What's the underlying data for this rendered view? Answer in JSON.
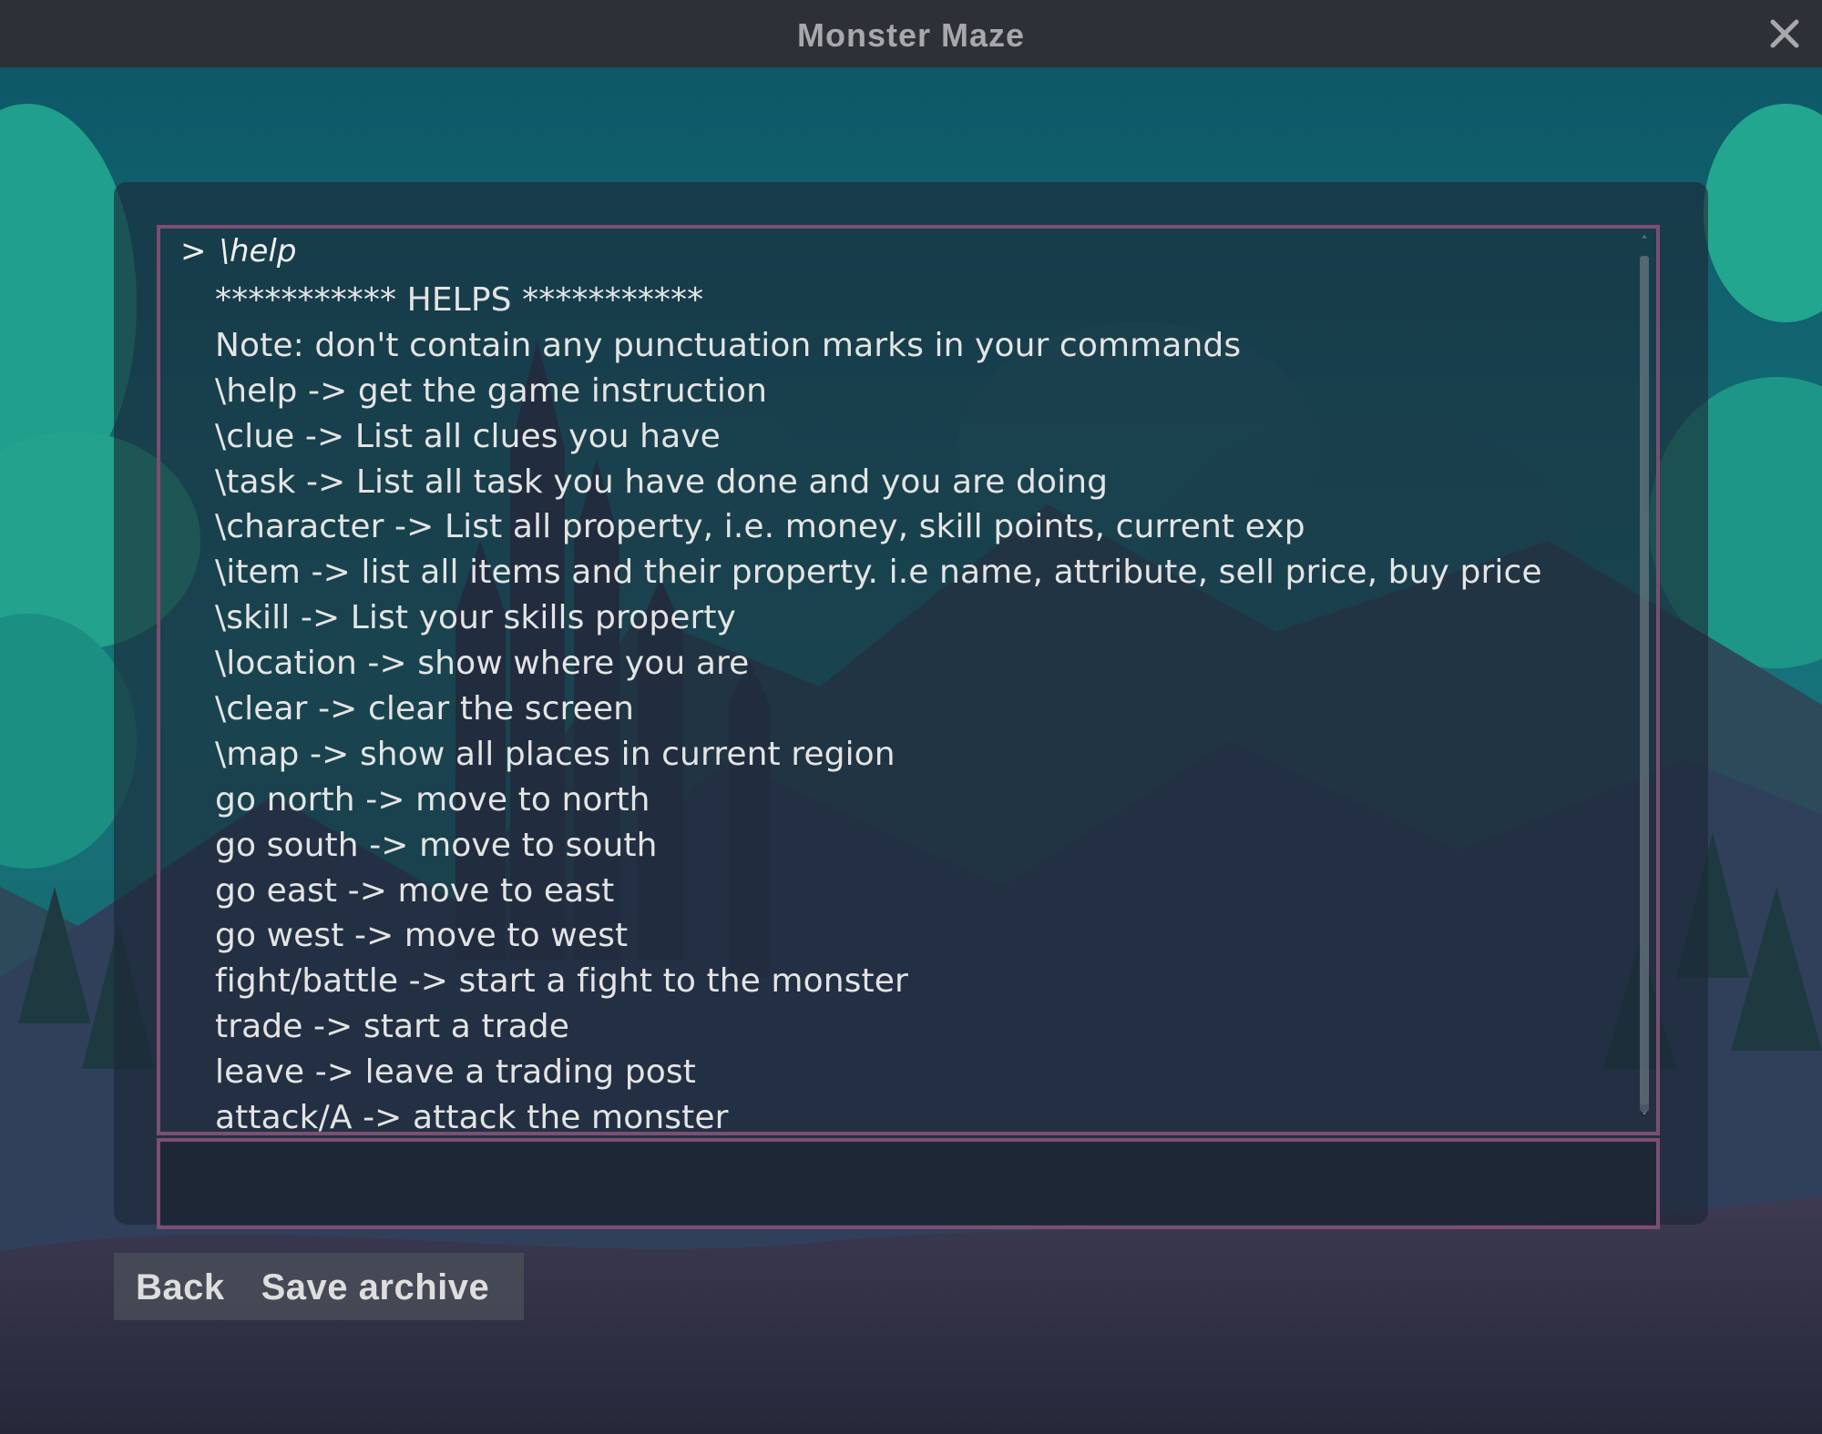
{
  "window": {
    "title": "Monster Maze",
    "close_icon": "close-icon"
  },
  "console": {
    "prompt_symbol": ">",
    "last_command": "\\help",
    "help_lines": [
      "*********** HELPS ***********",
      "Note: don't contain any punctuation marks in your commands",
      "\\help -> get the game instruction",
      "\\clue -> List all clues you have",
      "\\task -> List all task you have done and you are doing",
      "\\character -> List all property, i.e. money, skill points, current exp",
      "\\item -> list all items and their property. i.e name, attribute, sell price, buy price",
      "\\skill -> List your skills property",
      "\\location -> show where you are",
      "\\clear -> clear the screen",
      "\\map -> show all places in current region",
      "go north -> move to north",
      "go south -> move to south",
      "go east -> move to east",
      "go west -> move to west",
      "fight/battle -> start a fight to the monster",
      "trade -> start a trade",
      "leave -> leave a trading post",
      "attack/A -> attack the monster"
    ],
    "input_value": ""
  },
  "buttons": {
    "back_label": "Back",
    "save_label": "Save archive"
  },
  "colors": {
    "titlebar": "#2d3036",
    "title_text": "#a6a8ab",
    "panel_border": "#7c4f72",
    "console_text": "#e4e4e4",
    "sky_top": "#0f5a66",
    "sky_bottom": "#1d8a86"
  }
}
